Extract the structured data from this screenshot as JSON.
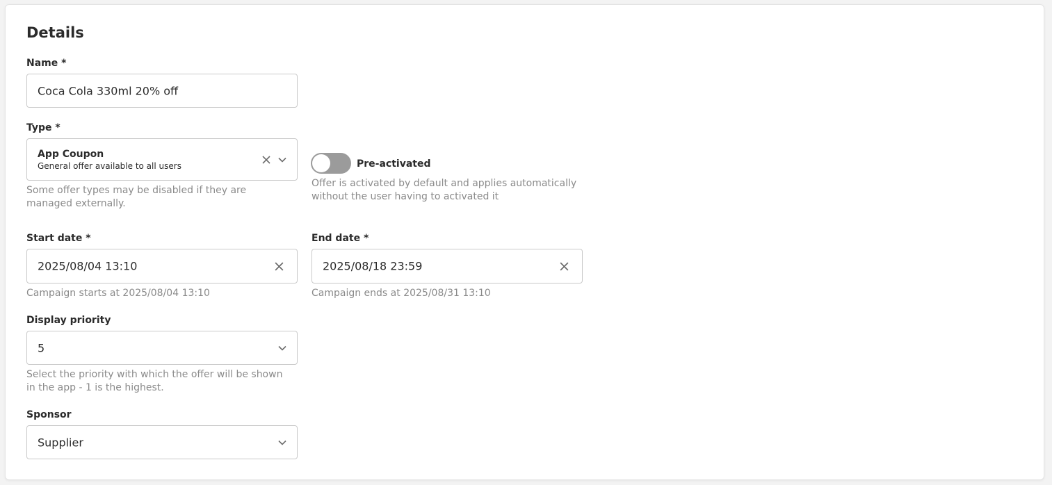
{
  "section": {
    "title": "Details"
  },
  "name": {
    "label": "Name *",
    "value": "Coca Cola 330ml 20% off"
  },
  "type": {
    "label": "Type *",
    "selected_title": "App Coupon",
    "selected_description": "General offer available to all users",
    "helper": "Some offer types may be disabled if they are managed externally."
  },
  "preactivated": {
    "label": "Pre-activated",
    "enabled": false,
    "helper": "Offer is activated by default and applies automatically without the user having to activated it"
  },
  "start_date": {
    "label": "Start date *",
    "value": "2025/08/04 13:10",
    "helper": "Campaign starts at 2025/08/04 13:10"
  },
  "end_date": {
    "label": "End date *",
    "value": "2025/08/18 23:59",
    "helper": "Campaign ends at 2025/08/31 13:10"
  },
  "display_priority": {
    "label": "Display priority",
    "value": "5",
    "helper": "Select the priority with which the offer will be shown in the app - 1 is the highest."
  },
  "sponsor": {
    "label": "Sponsor",
    "value": "Supplier"
  },
  "icons": {
    "clear": "close-icon",
    "dropdown": "chevron-down-icon"
  },
  "colors": {
    "toggle_off": "#9b9b9b",
    "helper_text": "#8a8a8a",
    "border": "#c9c9c9"
  }
}
